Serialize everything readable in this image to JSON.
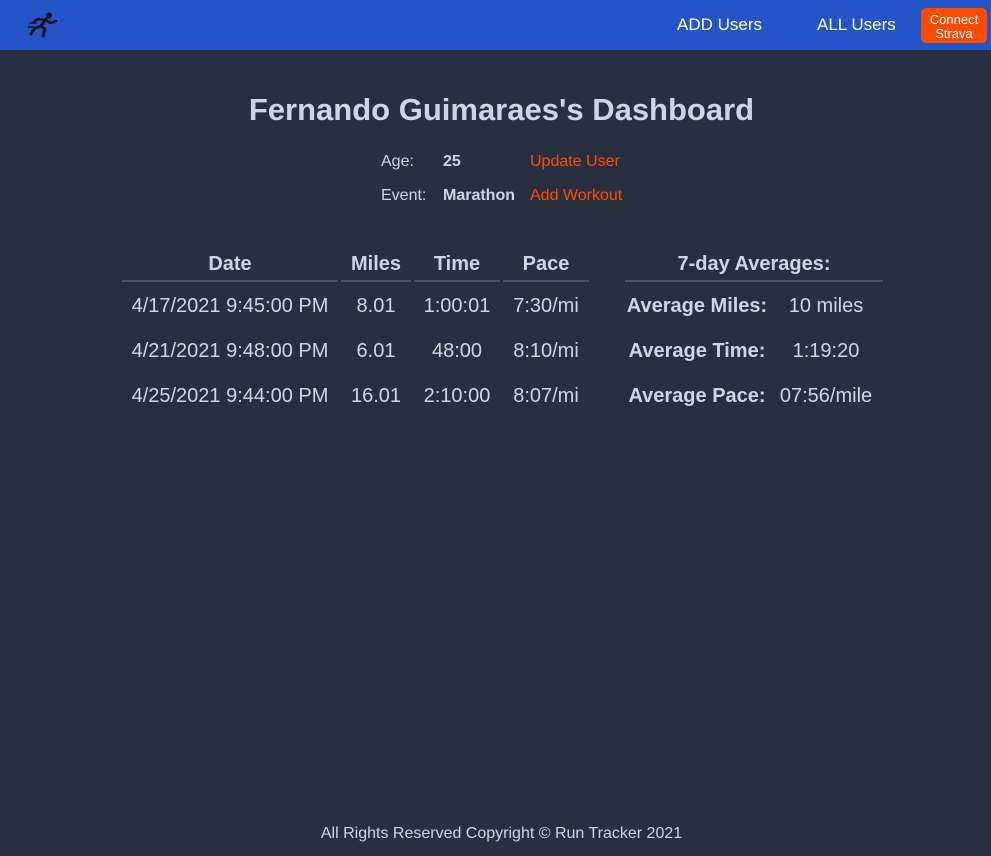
{
  "nav": {
    "logo_icon": "runner-icon",
    "add_users": "ADD Users",
    "all_users": "ALL Users",
    "strava_line1": "Connect",
    "strava_line2": "Strava"
  },
  "dashboard": {
    "title": "Fernando Guimaraes's Dashboard",
    "age_label": "Age:",
    "age_value": "25",
    "update_user": "Update User",
    "event_label": "Event:",
    "event_value": "Marathon",
    "add_workout": "Add Workout"
  },
  "workouts": {
    "headers": [
      "Date",
      "Miles",
      "Time",
      "Pace"
    ],
    "rows": [
      {
        "date": "4/17/2021 9:45:00 PM",
        "miles": "8.01",
        "time": "1:00:01",
        "pace": "7:30/mi"
      },
      {
        "date": "4/21/2021 9:48:00 PM",
        "miles": "6.01",
        "time": "48:00",
        "pace": "8:10/mi"
      },
      {
        "date": "4/25/2021 9:44:00 PM",
        "miles": "16.01",
        "time": "2:10:00",
        "pace": "8:07/mi"
      }
    ]
  },
  "averages": {
    "heading": "7-day Averages:",
    "rows": [
      {
        "label": "Average Miles:",
        "value": "10 miles"
      },
      {
        "label": "Average Time:",
        "value": "1:19:20"
      },
      {
        "label": "Average Pace:",
        "value": "07:56/mile"
      }
    ]
  },
  "footer": {
    "text": "All Rights Reserved Copyright © Run Tracker 2021"
  },
  "colors": {
    "navbar": "#2354c8",
    "background": "#283040",
    "accent": "#fc4c02",
    "text": "#cfd6e2"
  }
}
